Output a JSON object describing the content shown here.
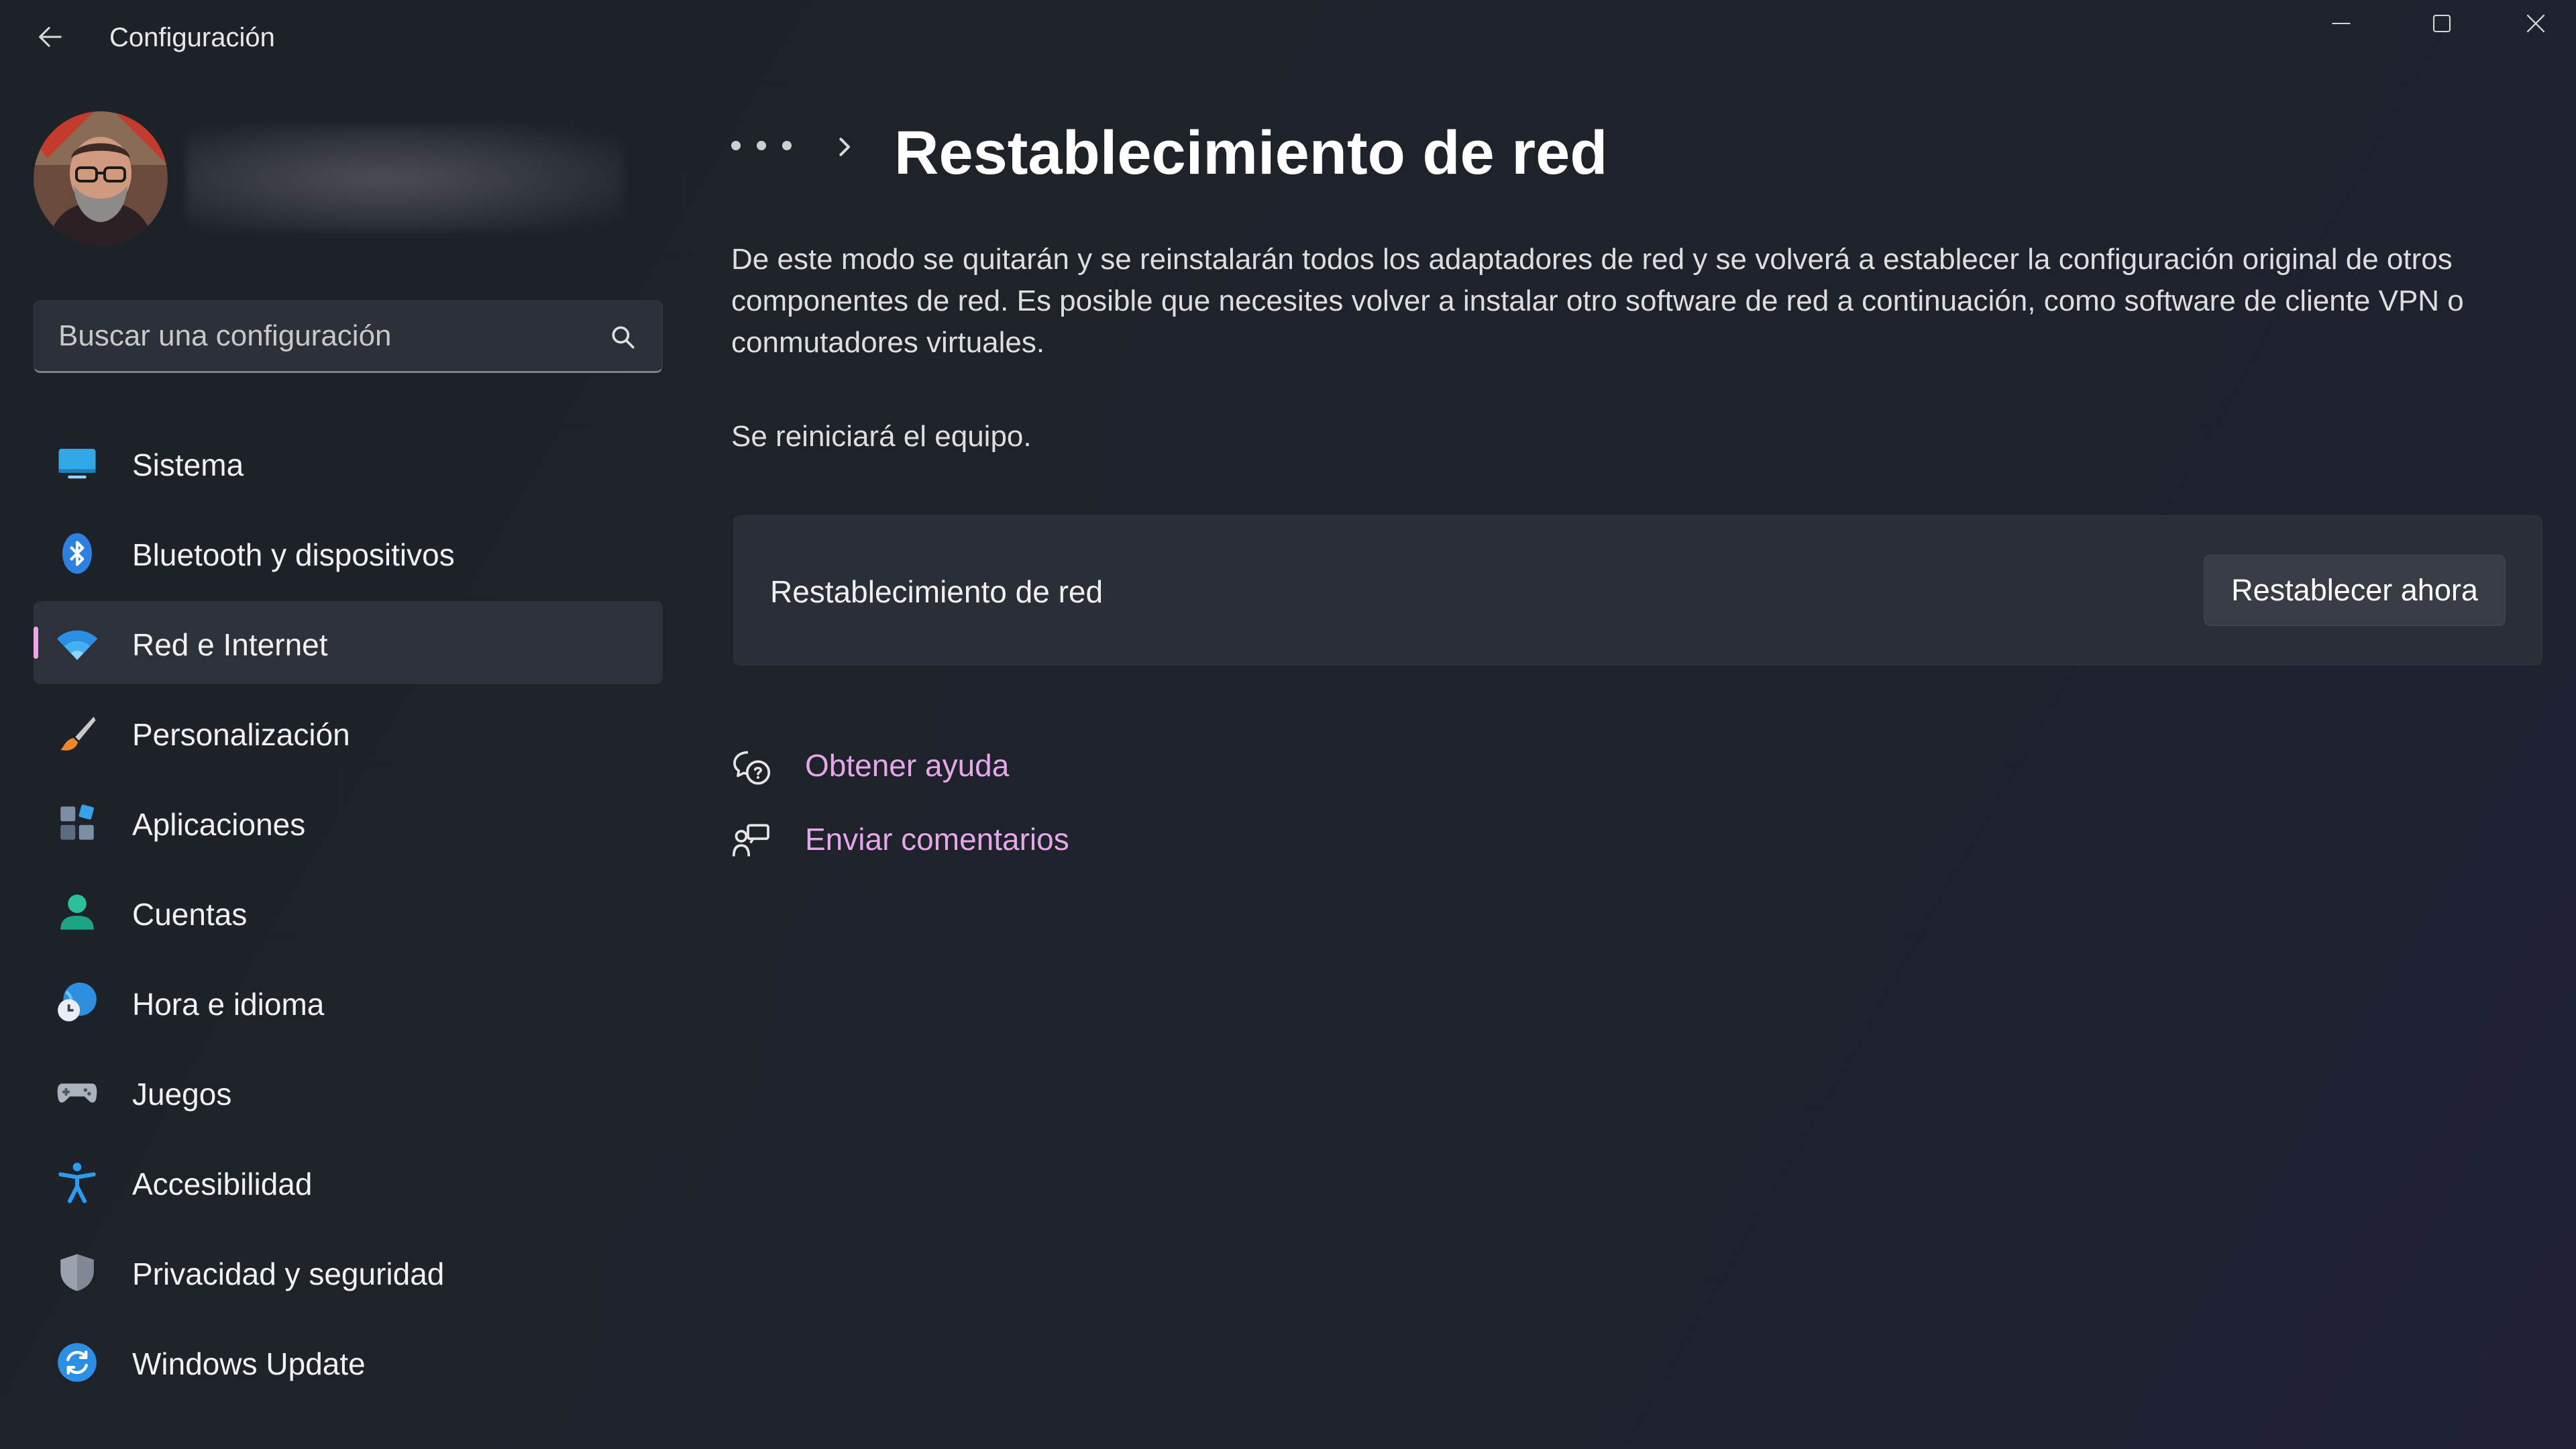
{
  "app": {
    "title": "Configuración"
  },
  "window_controls": {
    "minimize_icon": "minimize-icon",
    "maximize_icon": "maximize-icon",
    "close_icon": "close-icon"
  },
  "search": {
    "placeholder": "Buscar una configuración",
    "icon": "search-icon"
  },
  "sidebar": {
    "items": [
      {
        "label": "Sistema",
        "icon": "system-display-icon",
        "active": false
      },
      {
        "label": "Bluetooth y dispositivos",
        "icon": "bluetooth-icon",
        "active": false
      },
      {
        "label": "Red e Internet",
        "icon": "wifi-icon",
        "active": true
      },
      {
        "label": "Personalización",
        "icon": "brush-icon",
        "active": false
      },
      {
        "label": "Aplicaciones",
        "icon": "apps-icon",
        "active": false
      },
      {
        "label": "Cuentas",
        "icon": "account-icon",
        "active": false
      },
      {
        "label": "Hora e idioma",
        "icon": "time-language-icon",
        "active": false
      },
      {
        "label": "Juegos",
        "icon": "gamepad-icon",
        "active": false
      },
      {
        "label": "Accesibilidad",
        "icon": "accessibility-icon",
        "active": false
      },
      {
        "label": "Privacidad y seguridad",
        "icon": "shield-icon",
        "active": false
      },
      {
        "label": "Windows Update",
        "icon": "windows-update-icon",
        "active": false
      }
    ]
  },
  "main": {
    "breadcrumb_more": "more-icon",
    "title": "Restablecimiento de red",
    "description": "De este modo se quitarán y se reinstalarán todos los adaptadores de red y se volverá a establecer la configuración original de otros componentes de red. Es posible que necesites volver a instalar otro software de red a continuación, como software de cliente VPN o conmutadores virtuales.",
    "restart_note": "Se reiniciará el equipo.",
    "card": {
      "label": "Restablecimiento de red",
      "button": "Restablecer ahora"
    },
    "links": [
      {
        "label": "Obtener ayuda",
        "icon": "help-icon"
      },
      {
        "label": "Enviar comentarios",
        "icon": "feedback-icon"
      }
    ]
  },
  "colors": {
    "accent": "#e9a7ea",
    "link": "#e6a6ea",
    "background": "#1c2027",
    "card": "#2a2e36"
  }
}
